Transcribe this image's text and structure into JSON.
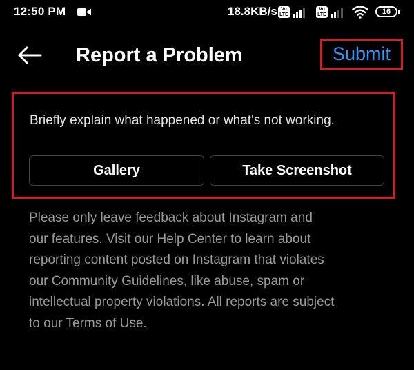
{
  "status_bar": {
    "time": "12:50 PM",
    "network_speed": "18.8KB/s",
    "volte_label": "Vo\nLTE",
    "battery_level": "16",
    "icons": [
      "video-camera-icon",
      "volte-icon",
      "signal-icon",
      "volte-icon",
      "signal-icon",
      "wifi-icon",
      "battery-icon"
    ]
  },
  "header": {
    "back_icon": "arrow-left-icon",
    "title": "Report a Problem",
    "submit_label": "Submit"
  },
  "form": {
    "input_placeholder": "Briefly explain what happened or what's not working.",
    "gallery_label": "Gallery",
    "screenshot_label": "Take Screenshot"
  },
  "disclaimer": {
    "lines": [
      "Please only leave feedback about Instagram and",
      "our features. Visit our Help Center to learn about",
      "reporting content posted on Instagram that violates",
      "our Community Guidelines, like abuse, spam or",
      "intellectual property violations. All reports are subject",
      "to our Terms of Use."
    ]
  },
  "colors": {
    "background": "#000000",
    "text_primary": "#ffffff",
    "text_secondary": "#9a9a9a",
    "accent_link": "#3797f0",
    "highlight_border": "#d11f26",
    "button_border": "#3f3f3f"
  }
}
